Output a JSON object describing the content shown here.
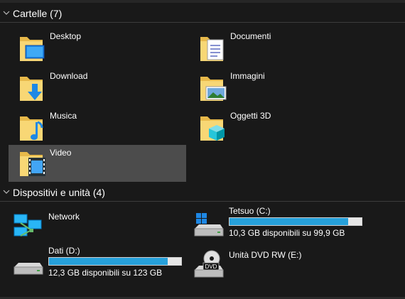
{
  "groups": {
    "folders_label": "Cartelle (7)",
    "devices_label": "Dispositivi e unità (4)"
  },
  "folders": [
    {
      "label": "Desktop"
    },
    {
      "label": "Documenti"
    },
    {
      "label": "Download"
    },
    {
      "label": "Immagini"
    },
    {
      "label": "Musica"
    },
    {
      "label": "Oggetti 3D"
    },
    {
      "label": "Video",
      "selected": true
    }
  ],
  "devices": [
    {
      "label": "Network"
    },
    {
      "label": "Tetsuo (C:)",
      "free_text": "10,3 GB disponibili su 99,9 GB",
      "used_fraction": 0.897
    },
    {
      "label": "Dati (D:)",
      "free_text": "12,3 GB disponibili su 123 GB",
      "used_fraction": 0.9
    },
    {
      "label": "Unità DVD RW (E:)",
      "icon_text": "DVD"
    }
  ],
  "colors": {
    "background": "#191919",
    "selection": "#4c4c4c",
    "bar_fill": "#26a0da",
    "bar_track": "#e6e6e6",
    "folder_yellow": "#f8d775"
  }
}
